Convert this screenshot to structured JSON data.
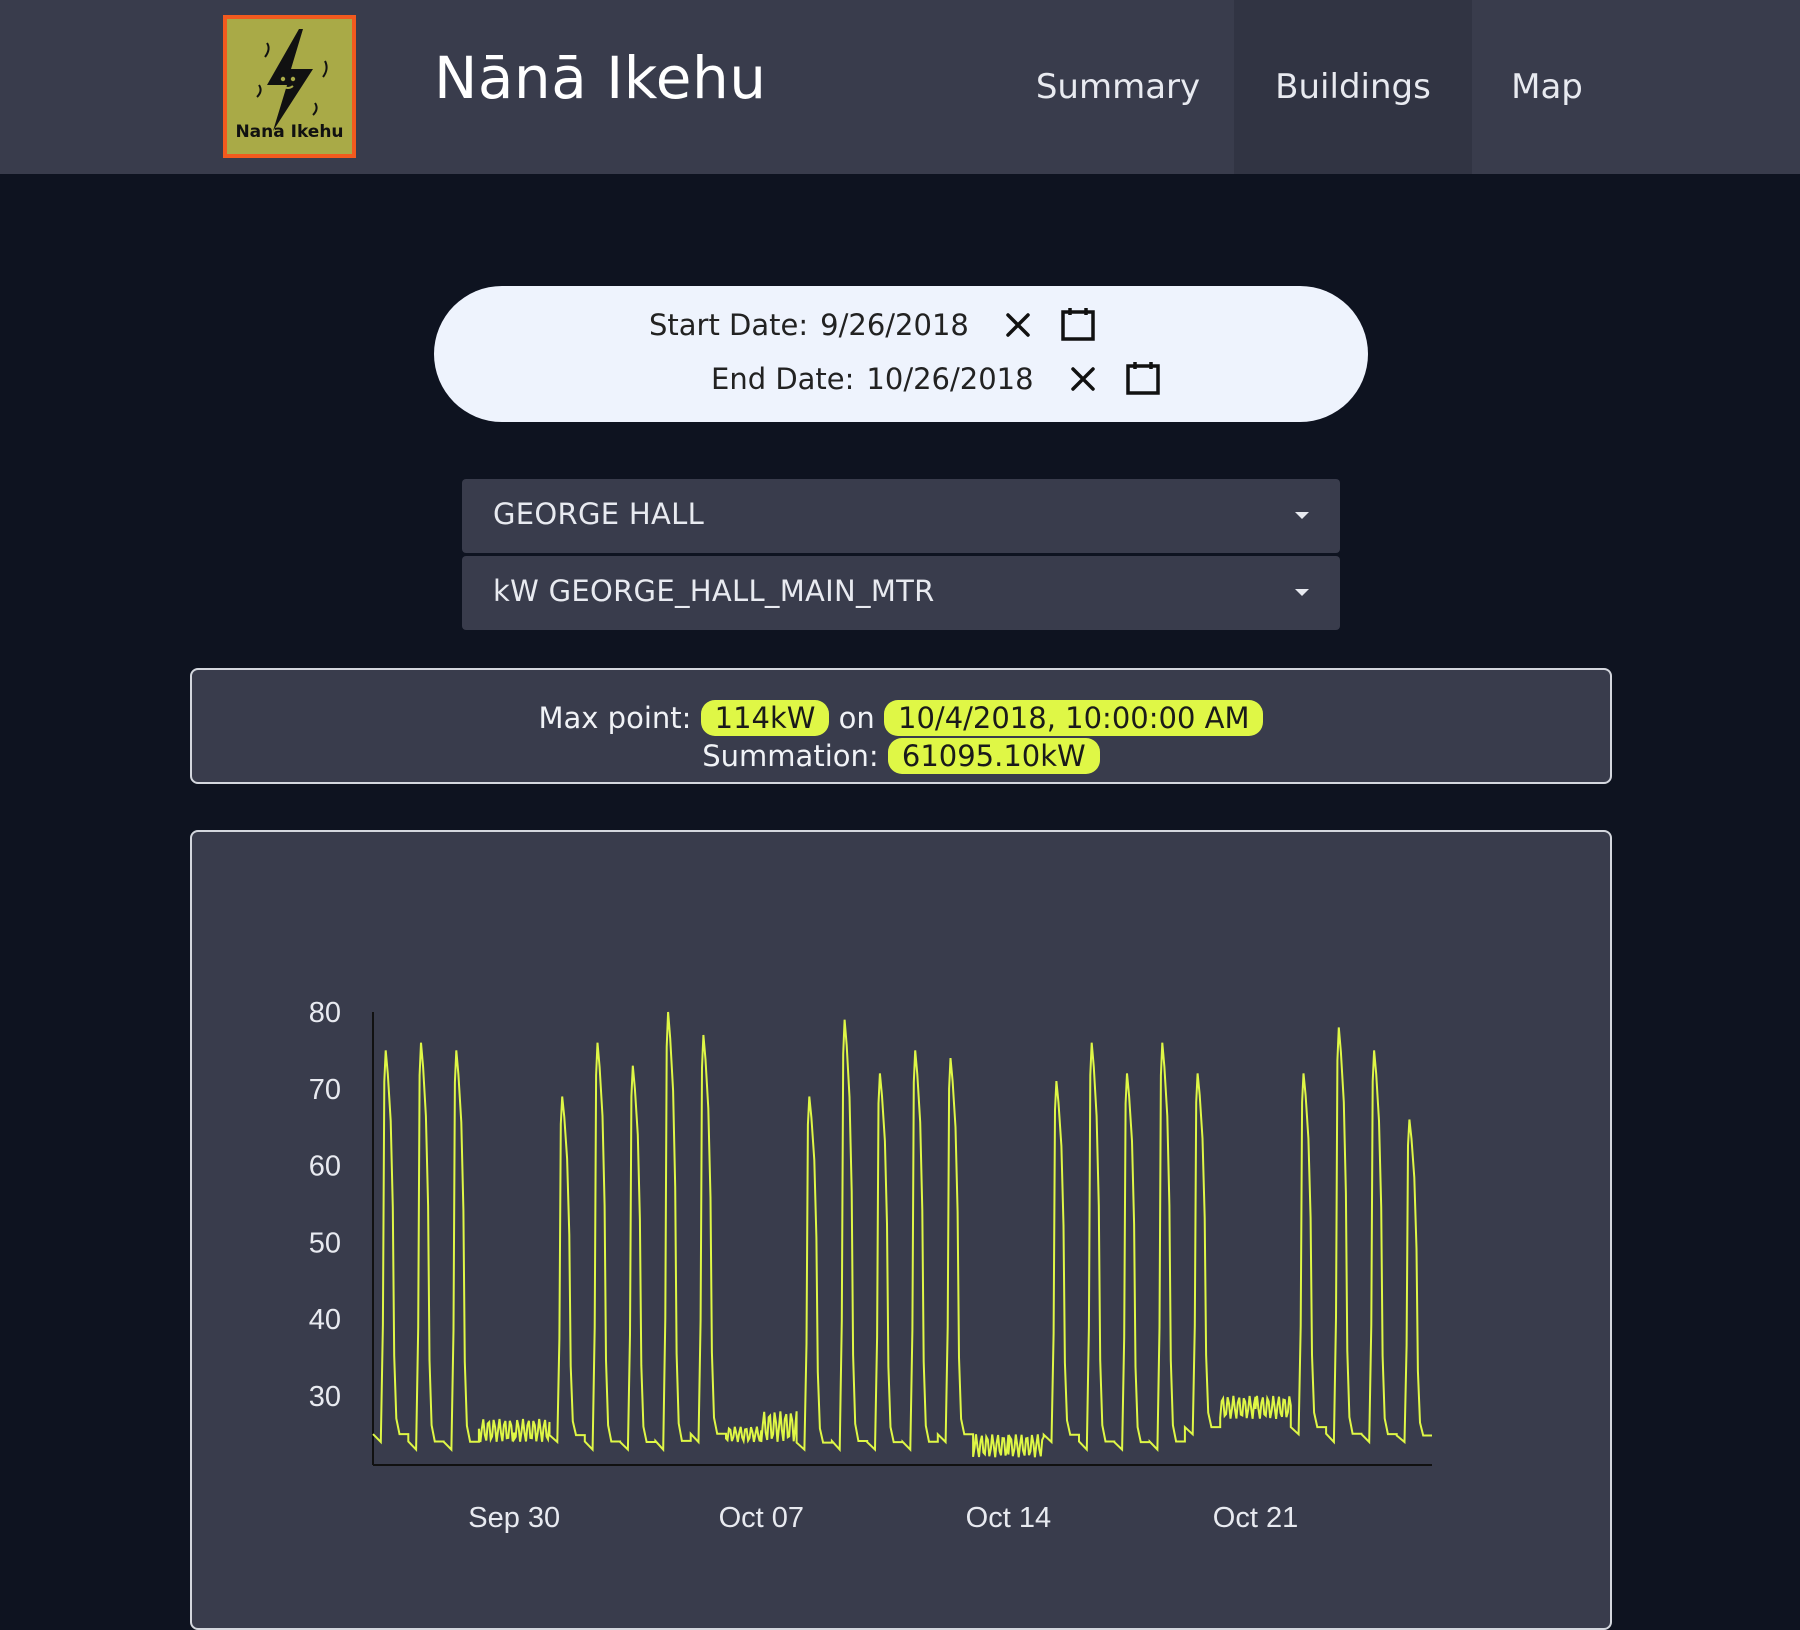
{
  "header": {
    "logo_text": "Nana Ikehu",
    "title": "Nānā Ikehu",
    "nav": [
      {
        "label": "Summary",
        "active": false
      },
      {
        "label": "Buildings",
        "active": true
      },
      {
        "label": "Map",
        "active": false
      }
    ]
  },
  "date_range": {
    "start_label": "Start Date:",
    "start_value": "9/26/2018",
    "end_label": "End Date:",
    "end_value": "10/26/2018"
  },
  "selects": {
    "building": "GEORGE HALL",
    "meter": "kW GEORGE_HALL_MAIN_MTR"
  },
  "stats": {
    "max_label": "Max point:",
    "max_value": "114kW",
    "on_label": "on",
    "max_time": "10/4/2018, 10:00:00 AM",
    "sum_label": "Summation:",
    "sum_value": "61095.10kW"
  },
  "colors": {
    "accent": "#dff746",
    "navbar": "#393c4c",
    "page_bg": "#0e1320",
    "logo_border": "#f25a1e"
  },
  "chart_data": {
    "type": "line",
    "title": "",
    "xlabel": "",
    "ylabel": "",
    "y_ticks": [
      80,
      70,
      60,
      50,
      40,
      30
    ],
    "x_ticks": [
      "Sep 30",
      "Oct 07",
      "Oct 14",
      "Oct 21"
    ],
    "x_tick_dates": [
      "2018-09-30",
      "2018-10-07",
      "2018-10-14",
      "2018-10-21"
    ],
    "ylim": [
      21,
      80
    ],
    "x_range": [
      "2018-09-26",
      "2018-10-26"
    ],
    "grid": false,
    "series": [
      {
        "color": "#dff746",
        "daily": [
          {
            "date": "2018-09-26",
            "peak": 75,
            "min": 24
          },
          {
            "date": "2018-09-27",
            "peak": 76,
            "min": 23
          },
          {
            "date": "2018-09-28",
            "peak": 75,
            "min": 23
          },
          {
            "date": "2018-09-29",
            "peak": 27,
            "min": 24
          },
          {
            "date": "2018-09-30",
            "peak": 27,
            "min": 24
          },
          {
            "date": "2018-10-01",
            "peak": 69,
            "min": 24
          },
          {
            "date": "2018-10-02",
            "peak": 76,
            "min": 23
          },
          {
            "date": "2018-10-03",
            "peak": 73,
            "min": 23
          },
          {
            "date": "2018-10-04",
            "peak": 80,
            "min": 23
          },
          {
            "date": "2018-10-05",
            "peak": 77,
            "min": 24
          },
          {
            "date": "2018-10-06",
            "peak": 26,
            "min": 24
          },
          {
            "date": "2018-10-07",
            "peak": 28,
            "min": 24
          },
          {
            "date": "2018-10-08",
            "peak": 69,
            "min": 23
          },
          {
            "date": "2018-10-09",
            "peak": 79,
            "min": 23
          },
          {
            "date": "2018-10-10",
            "peak": 72,
            "min": 23
          },
          {
            "date": "2018-10-11",
            "peak": 75,
            "min": 23
          },
          {
            "date": "2018-10-12",
            "peak": 74,
            "min": 24
          },
          {
            "date": "2018-10-13",
            "peak": 25,
            "min": 22
          },
          {
            "date": "2018-10-14",
            "peak": 25,
            "min": 22
          },
          {
            "date": "2018-10-15",
            "peak": 71,
            "min": 24
          },
          {
            "date": "2018-10-16",
            "peak": 76,
            "min": 23
          },
          {
            "date": "2018-10-17",
            "peak": 72,
            "min": 23
          },
          {
            "date": "2018-10-18",
            "peak": 76,
            "min": 23
          },
          {
            "date": "2018-10-19",
            "peak": 72,
            "min": 25
          },
          {
            "date": "2018-10-20",
            "peak": 30,
            "min": 27
          },
          {
            "date": "2018-10-21",
            "peak": 30,
            "min": 27
          },
          {
            "date": "2018-10-22",
            "peak": 72,
            "min": 25
          },
          {
            "date": "2018-10-23",
            "peak": 78,
            "min": 24
          },
          {
            "date": "2018-10-24",
            "peak": 75,
            "min": 24
          },
          {
            "date": "2018-10-25",
            "peak": 66,
            "min": 24
          }
        ]
      }
    ]
  }
}
